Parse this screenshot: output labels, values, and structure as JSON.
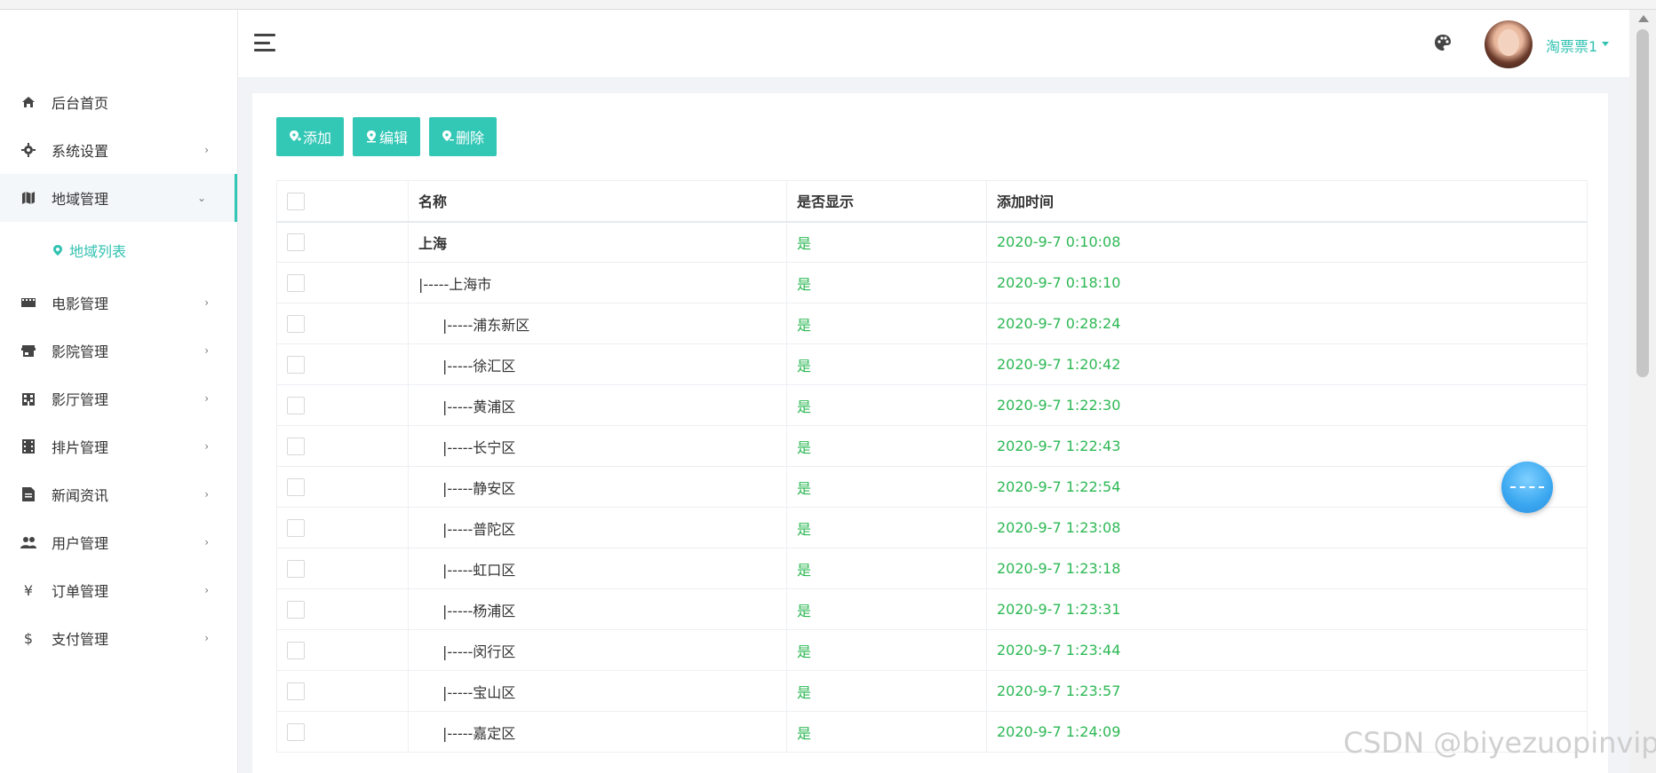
{
  "sidebar": {
    "items": [
      {
        "label": "后台首页",
        "icon": "home-icon",
        "has_chevron": false
      },
      {
        "label": "系统设置",
        "icon": "gear-icon",
        "has_chevron": true
      },
      {
        "label": "地域管理",
        "icon": "map-icon",
        "has_chevron": true,
        "expanded": true
      },
      {
        "label": "电影管理",
        "icon": "film-icon",
        "has_chevron": true
      },
      {
        "label": "影院管理",
        "icon": "store-icon",
        "has_chevron": true
      },
      {
        "label": "影厅管理",
        "icon": "building-icon",
        "has_chevron": true
      },
      {
        "label": "排片管理",
        "icon": "schedule-icon",
        "has_chevron": true
      },
      {
        "label": "新闻资讯",
        "icon": "news-icon",
        "has_chevron": true
      },
      {
        "label": "用户管理",
        "icon": "users-icon",
        "has_chevron": true
      },
      {
        "label": "订单管理",
        "icon": "yen-icon",
        "has_chevron": true
      },
      {
        "label": "支付管理",
        "icon": "dollar-icon",
        "has_chevron": true
      }
    ],
    "submenu": {
      "label": "地域列表",
      "icon": "location-icon"
    }
  },
  "header": {
    "user_name": "淘票票1",
    "icon_yen": "¥",
    "icon_dollar": "$"
  },
  "toolbar": {
    "add_label": "添加",
    "edit_label": "编辑",
    "delete_label": "删除"
  },
  "table": {
    "columns": [
      "名称",
      "是否显示",
      "添加时间"
    ],
    "rows": [
      {
        "prefix": "",
        "name": "上海",
        "show": "是",
        "time": "2020-9-7 0:10:08",
        "level": 0
      },
      {
        "prefix": "|-----",
        "name": "上海市",
        "show": "是",
        "time": "2020-9-7 0:18:10",
        "level": 1
      },
      {
        "prefix": "|-----",
        "name": "浦东新区",
        "show": "是",
        "time": "2020-9-7 0:28:24",
        "level": 2
      },
      {
        "prefix": "|-----",
        "name": "徐汇区",
        "show": "是",
        "time": "2020-9-7 1:20:42",
        "level": 2
      },
      {
        "prefix": "|-----",
        "name": "黄浦区",
        "show": "是",
        "time": "2020-9-7 1:22:30",
        "level": 2
      },
      {
        "prefix": "|-----",
        "name": "长宁区",
        "show": "是",
        "time": "2020-9-7 1:22:43",
        "level": 2
      },
      {
        "prefix": "|-----",
        "name": "静安区",
        "show": "是",
        "time": "2020-9-7 1:22:54",
        "level": 2
      },
      {
        "prefix": "|-----",
        "name": "普陀区",
        "show": "是",
        "time": "2020-9-7 1:23:08",
        "level": 2
      },
      {
        "prefix": "|-----",
        "name": "虹口区",
        "show": "是",
        "time": "2020-9-7 1:23:18",
        "level": 2
      },
      {
        "prefix": "|-----",
        "name": "杨浦区",
        "show": "是",
        "time": "2020-9-7 1:23:31",
        "level": 2
      },
      {
        "prefix": "|-----",
        "name": "闵行区",
        "show": "是",
        "time": "2020-9-7 1:23:44",
        "level": 2
      },
      {
        "prefix": "|-----",
        "name": "宝山区",
        "show": "是",
        "time": "2020-9-7 1:23:57",
        "level": 2
      },
      {
        "prefix": "|-----",
        "name": "嘉定区",
        "show": "是",
        "time": "2020-9-7 1:24:09",
        "level": 2
      }
    ]
  },
  "watermark": "CSDN @biyezuopinvip",
  "colors": {
    "accent": "#33c7b6",
    "status_green": "#2db854"
  }
}
